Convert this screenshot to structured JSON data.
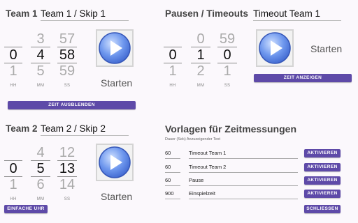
{
  "team1": {
    "label": "Team 1",
    "name": "Team 1 / Skip 1",
    "hh": {
      "up": "",
      "cur": "0",
      "dn": "1"
    },
    "mm": {
      "up": "3",
      "cur": "4",
      "dn": "5"
    },
    "ss": {
      "up": "57",
      "cur": "58",
      "dn": "59"
    },
    "labels": {
      "hh": "HH",
      "mm": "MM",
      "ss": "SS"
    },
    "start_label": "Starten",
    "hide_button": "ZEIT AUSBLENDEN"
  },
  "pause": {
    "label": "Pausen / Timeouts",
    "name": "Timeout Team 1",
    "hh": {
      "up": "",
      "cur": "0",
      "dn": "1"
    },
    "mm": {
      "up": "0",
      "cur": "1",
      "dn": "2"
    },
    "ss": {
      "up": "59",
      "cur": "0",
      "dn": "1"
    },
    "labels": {
      "hh": "HH",
      "mm": "MM",
      "ss": "SS"
    },
    "start_label": "Starten",
    "show_button": "ZEIT ANZEIGEN"
  },
  "team2": {
    "label": "Team 2",
    "name": "Team 2 / Skip 2",
    "hh": {
      "up": "",
      "cur": "0",
      "dn": "1"
    },
    "mm": {
      "up": "4",
      "cur": "5",
      "dn": "6"
    },
    "ss": {
      "up": "12",
      "cur": "13",
      "dn": "14"
    },
    "labels": {
      "hh": "HH",
      "mm": "MM",
      "ss": "SS"
    },
    "start_label": "Starten",
    "simple_clock_button": "EINFACHE UHR"
  },
  "templates": {
    "title": "Vorlagen für Zeitmessungen",
    "subtitle": "Dauer (Sek) Anzuzeigender Text",
    "rows": [
      {
        "duration": "60",
        "text": "Timeout Team 1",
        "button": "AKTIVIEREN"
      },
      {
        "duration": "60",
        "text": "Timeout Team 2",
        "button": "AKTIVIEREN"
      },
      {
        "duration": "60",
        "text": "Pause",
        "button": "AKTIVIEREN"
      },
      {
        "duration": "900",
        "text": "Einspielzeit",
        "button": "AKTIVIEREN"
      }
    ],
    "close_button": "SCHLIESSEN"
  },
  "icons": {
    "play": "play-circle-icon"
  },
  "colors": {
    "accent": "#5e4aa8",
    "play_blue": "#4f7ee8"
  }
}
